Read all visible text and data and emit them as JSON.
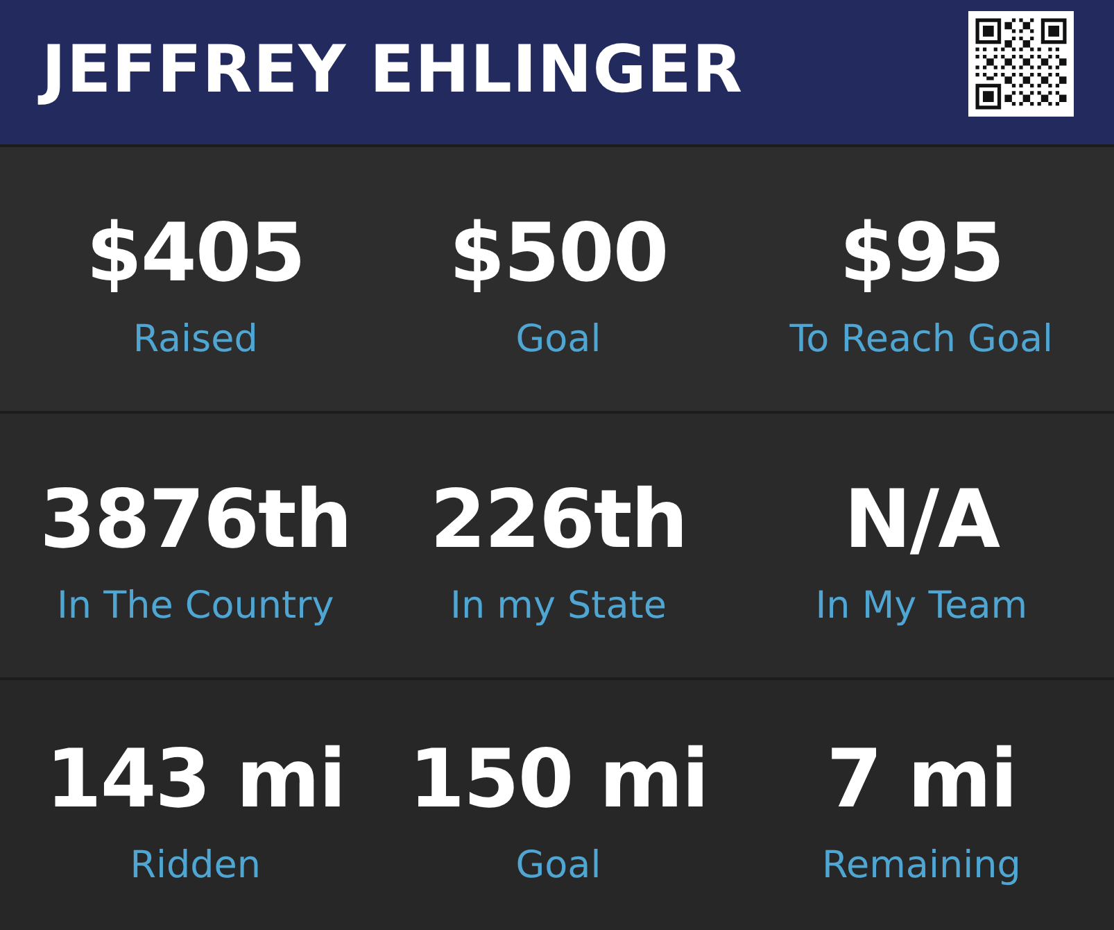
{
  "header": {
    "name": "JEFFREY EHLINGER"
  },
  "rows": [
    {
      "stats": [
        {
          "value": "$405",
          "label": "Raised"
        },
        {
          "value": "$500",
          "label": "Goal"
        },
        {
          "value": "$95",
          "label": "To Reach Goal"
        }
      ]
    },
    {
      "stats": [
        {
          "value": "3876th",
          "label": "In The Country"
        },
        {
          "value": "226th",
          "label": "In my State"
        },
        {
          "value": "N/A",
          "label": "In My Team"
        }
      ]
    },
    {
      "stats": [
        {
          "value": "143 mi",
          "label": "Ridden"
        },
        {
          "value": "150 mi",
          "label": "Goal"
        },
        {
          "value": "7 mi",
          "label": "Remaining"
        }
      ]
    }
  ]
}
